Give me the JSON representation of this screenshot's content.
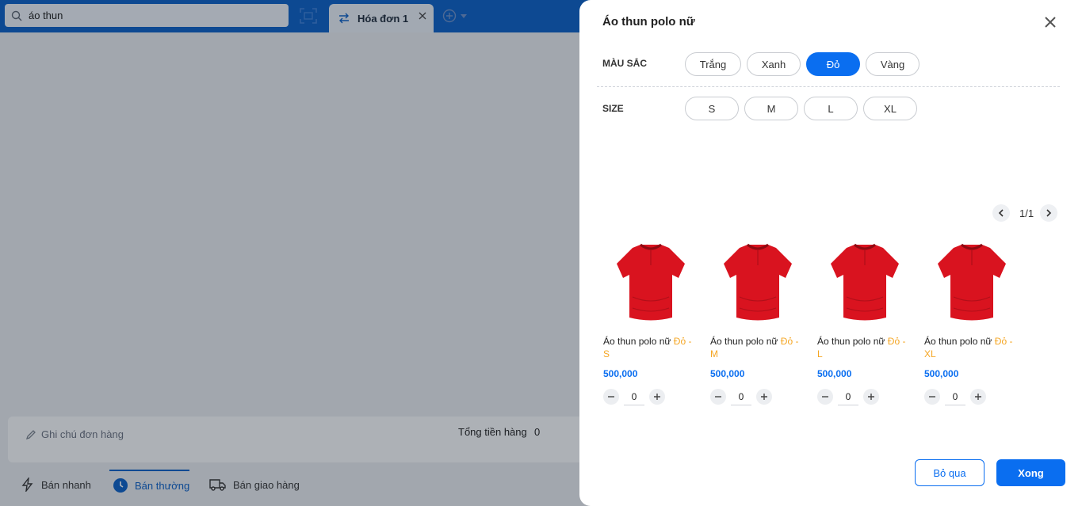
{
  "search": {
    "value": "áo thun",
    "icon": "search-icon"
  },
  "invoice_tab": {
    "label": "Hóa đơn 1"
  },
  "order": {
    "note_placeholder": "Ghi chú đơn hàng",
    "total_label": "Tổng tiền hàng",
    "total_value": "0"
  },
  "modes": [
    {
      "label": "Bán nhanh",
      "icon": "lightning-icon"
    },
    {
      "label": "Bán thường",
      "icon": "clock-icon"
    },
    {
      "label": "Bán giao hàng",
      "icon": "truck-icon"
    }
  ],
  "drawer": {
    "title": "Áo thun polo nữ",
    "color_label": "MÀU SẮC",
    "colors": [
      "Trắng",
      "Xanh",
      "Đỏ",
      "Vàng"
    ],
    "selected_color": "Đỏ",
    "size_label": "SIZE",
    "sizes": [
      "S",
      "M",
      "L",
      "XL"
    ],
    "page": "1/1",
    "products": [
      {
        "name": "Áo thun polo nữ",
        "variant": "Đỏ - S",
        "price": "500,000",
        "qty": "0"
      },
      {
        "name": "Áo thun polo nữ",
        "variant": "Đỏ - M",
        "price": "500,000",
        "qty": "0"
      },
      {
        "name": "Áo thun polo nữ",
        "variant": "Đỏ - L",
        "price": "500,000",
        "qty": "0"
      },
      {
        "name": "Áo thun polo nữ",
        "variant": "Đỏ - XL",
        "price": "500,000",
        "qty": "0"
      }
    ],
    "skip_label": "Bỏ qua",
    "done_label": "Xong"
  },
  "colors": {
    "primary": "#0a6ef0",
    "header": "#0b5fc5",
    "accent_variant": "#f5a623",
    "shirt": "#d9131f"
  }
}
